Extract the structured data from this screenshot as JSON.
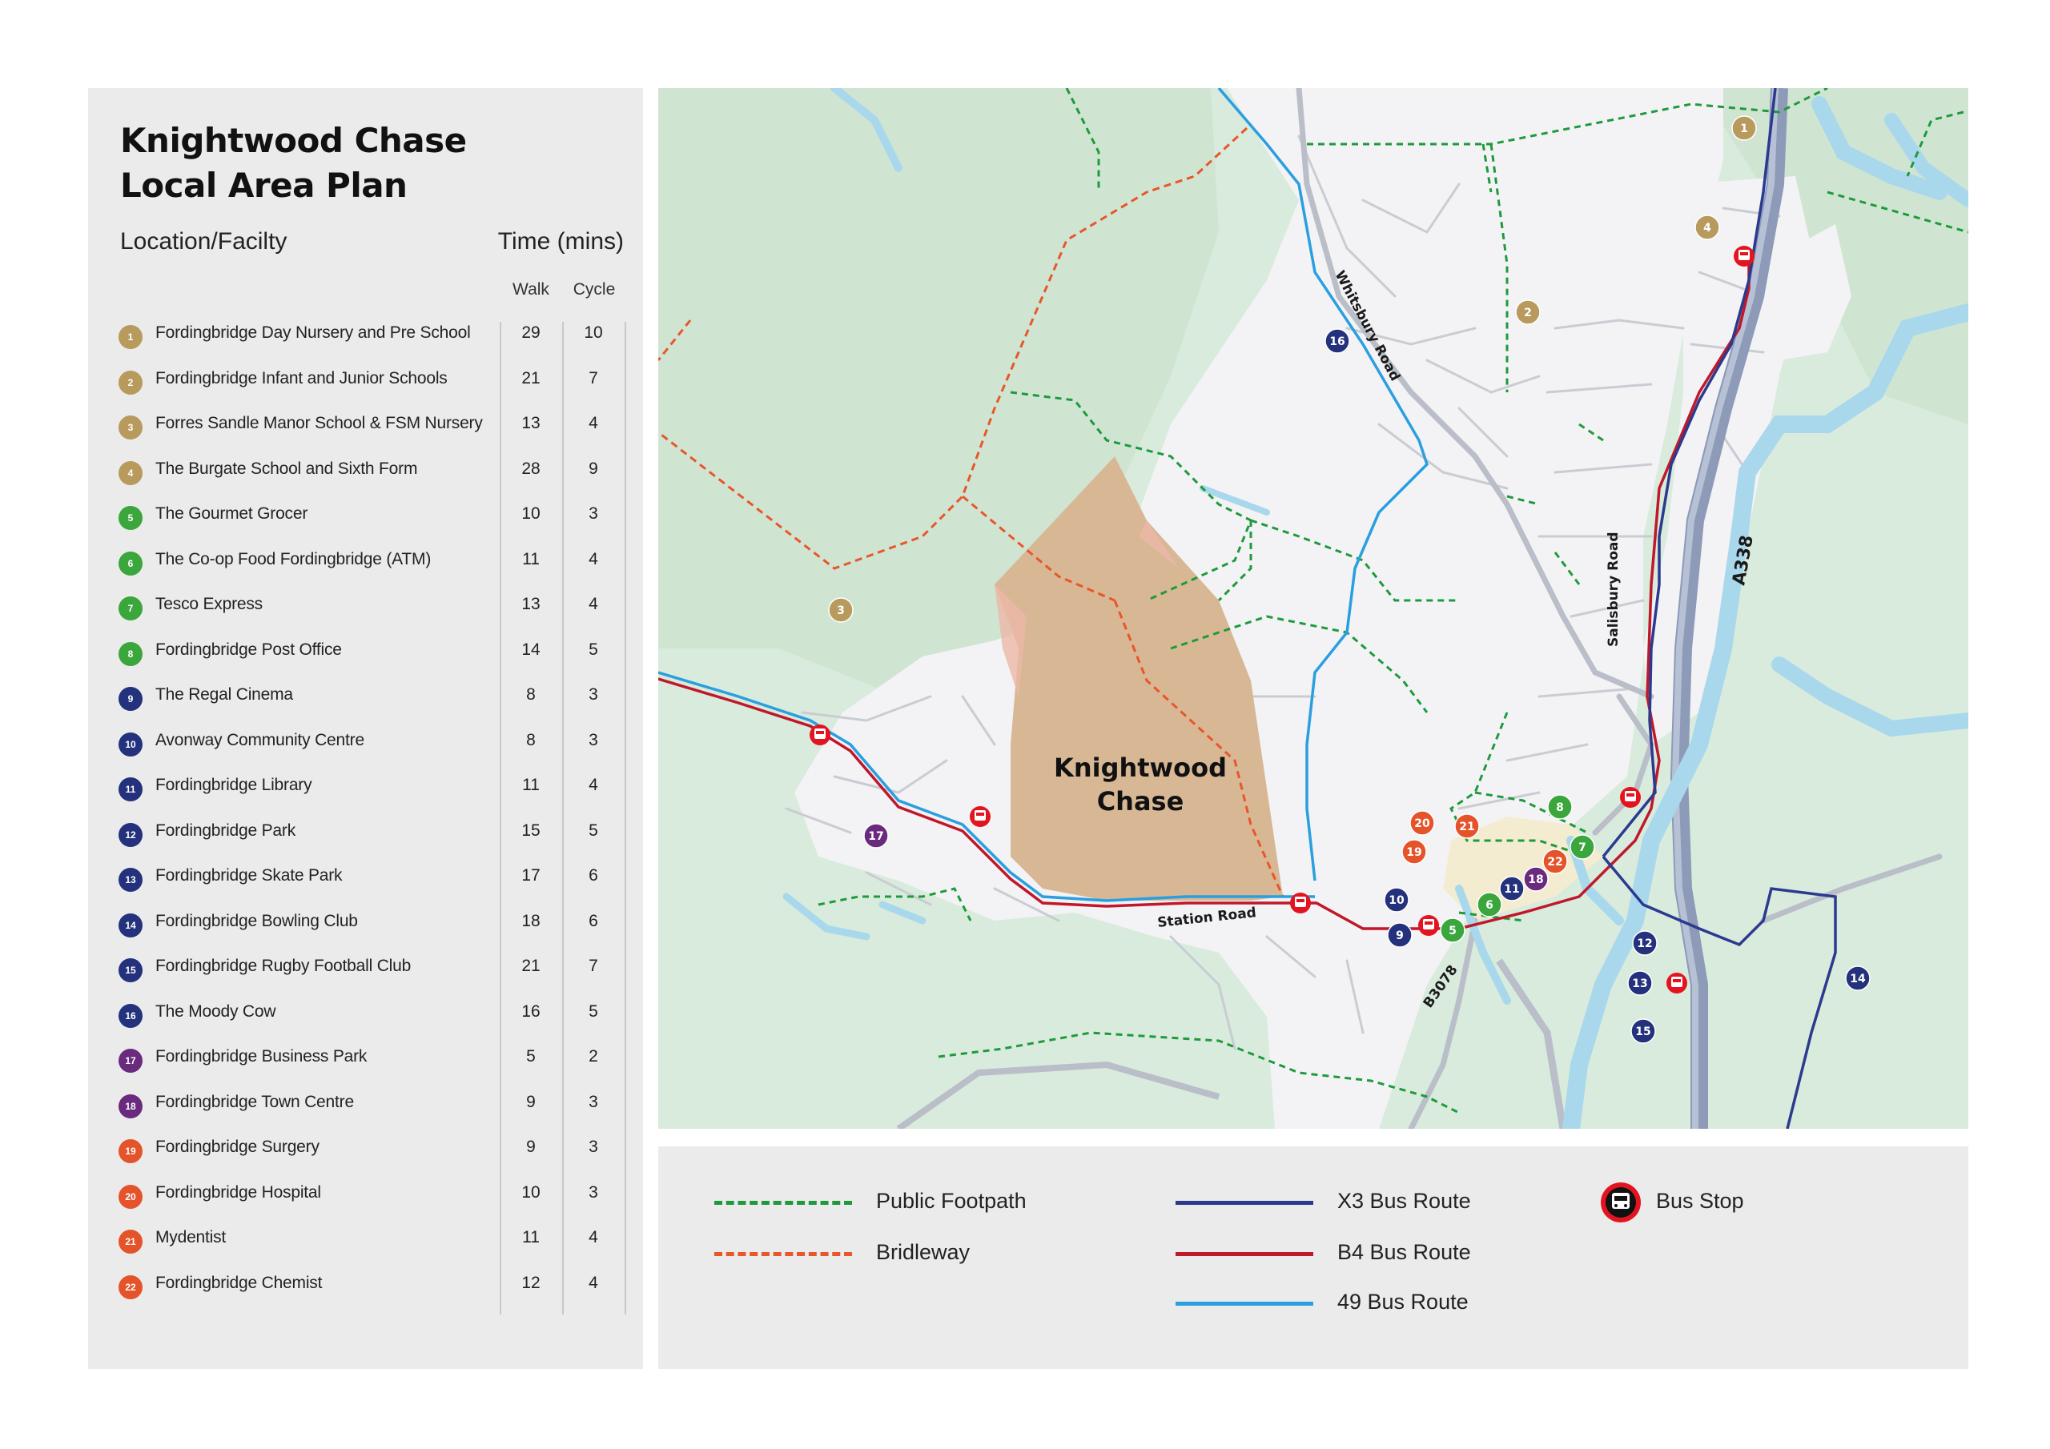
{
  "panel": {
    "title_line1": "Knightwood Chase",
    "title_line2": "Local Area Plan",
    "col_location": "Location/Facilty",
    "col_time": "Time (mins)",
    "col_walk": "Walk",
    "col_cycle": "Cycle"
  },
  "facilities": [
    {
      "num": "1",
      "name": "Fordingbridge Day Nursery and Pre School",
      "walk": "29",
      "cycle": "10",
      "color": "#b79a5c"
    },
    {
      "num": "2",
      "name": "Fordingbridge Infant and Junior Schools",
      "walk": "21",
      "cycle": "7",
      "color": "#b79a5c"
    },
    {
      "num": "3",
      "name": "Forres Sandle Manor School & FSM Nursery",
      "walk": "13",
      "cycle": "4",
      "color": "#b79a5c"
    },
    {
      "num": "4",
      "name": "The Burgate School and Sixth Form",
      "walk": "28",
      "cycle": "9",
      "color": "#b79a5c"
    },
    {
      "num": "5",
      "name": "The Gourmet Grocer",
      "walk": "10",
      "cycle": "3",
      "color": "#3aa63c"
    },
    {
      "num": "6",
      "name": "The Co-op Food Fordingbridge (ATM)",
      "walk": "11",
      "cycle": "4",
      "color": "#3aa63c"
    },
    {
      "num": "7",
      "name": "Tesco Express",
      "walk": "13",
      "cycle": "4",
      "color": "#3aa63c"
    },
    {
      "num": "8",
      "name": "Fordingbridge Post Office",
      "walk": "14",
      "cycle": "5",
      "color": "#3aa63c"
    },
    {
      "num": "9",
      "name": "The Regal Cinema",
      "walk": "8",
      "cycle": "3",
      "color": "#24317c"
    },
    {
      "num": "10",
      "name": "Avonway Community Centre",
      "walk": "8",
      "cycle": "3",
      "color": "#24317c"
    },
    {
      "num": "11",
      "name": "Fordingbridge Library",
      "walk": "11",
      "cycle": "4",
      "color": "#24317c"
    },
    {
      "num": "12",
      "name": "Fordingbridge Park",
      "walk": "15",
      "cycle": "5",
      "color": "#24317c"
    },
    {
      "num": "13",
      "name": "Fordingbridge Skate Park",
      "walk": "17",
      "cycle": "6",
      "color": "#24317c"
    },
    {
      "num": "14",
      "name": "Fordingbridge Bowling Club",
      "walk": "18",
      "cycle": "6",
      "color": "#24317c"
    },
    {
      "num": "15",
      "name": "Fordingbridge Rugby Football Club",
      "walk": "21",
      "cycle": "7",
      "color": "#24317c"
    },
    {
      "num": "16",
      "name": "The Moody Cow",
      "walk": "16",
      "cycle": "5",
      "color": "#24317c"
    },
    {
      "num": "17",
      "name": "Fordingbridge Business Park",
      "walk": "5",
      "cycle": "2",
      "color": "#6a2a7e"
    },
    {
      "num": "18",
      "name": "Fordingbridge Town Centre",
      "walk": "9",
      "cycle": "3",
      "color": "#6a2a7e"
    },
    {
      "num": "19",
      "name": "Fordingbridge Surgery",
      "walk": "9",
      "cycle": "3",
      "color": "#e5532a"
    },
    {
      "num": "20",
      "name": "Fordingbridge Hospital",
      "walk": "10",
      "cycle": "3",
      "color": "#e5532a"
    },
    {
      "num": "21",
      "name": "Mydentist",
      "walk": "11",
      "cycle": "4",
      "color": "#e5532a"
    },
    {
      "num": "22",
      "name": "Fordingbridge Chemist",
      "walk": "12",
      "cycle": "4",
      "color": "#e5532a"
    }
  ],
  "map": {
    "site_label_line1": "Knightwood",
    "site_label_line2": "Chase",
    "roads": {
      "whitsbury": "Whitsbury Road",
      "salisbury": "Salisbury Road",
      "a338": "A338",
      "station": "Station Road",
      "b3078": "B3078"
    }
  },
  "legend": {
    "footpath": {
      "label": "Public Footpath",
      "color": "#1e9a3c"
    },
    "bridleway": {
      "label": "Bridleway",
      "color": "#e8562a"
    },
    "x3": {
      "label": "X3 Bus Route",
      "color": "#2b3a8f"
    },
    "b4": {
      "label": "B4 Bus Route",
      "color": "#c0182b"
    },
    "r49": {
      "label": "49 Bus Route",
      "color": "#2a9fe0"
    },
    "bus_stop": {
      "label": "Bus Stop",
      "color": "#e3141f"
    }
  }
}
